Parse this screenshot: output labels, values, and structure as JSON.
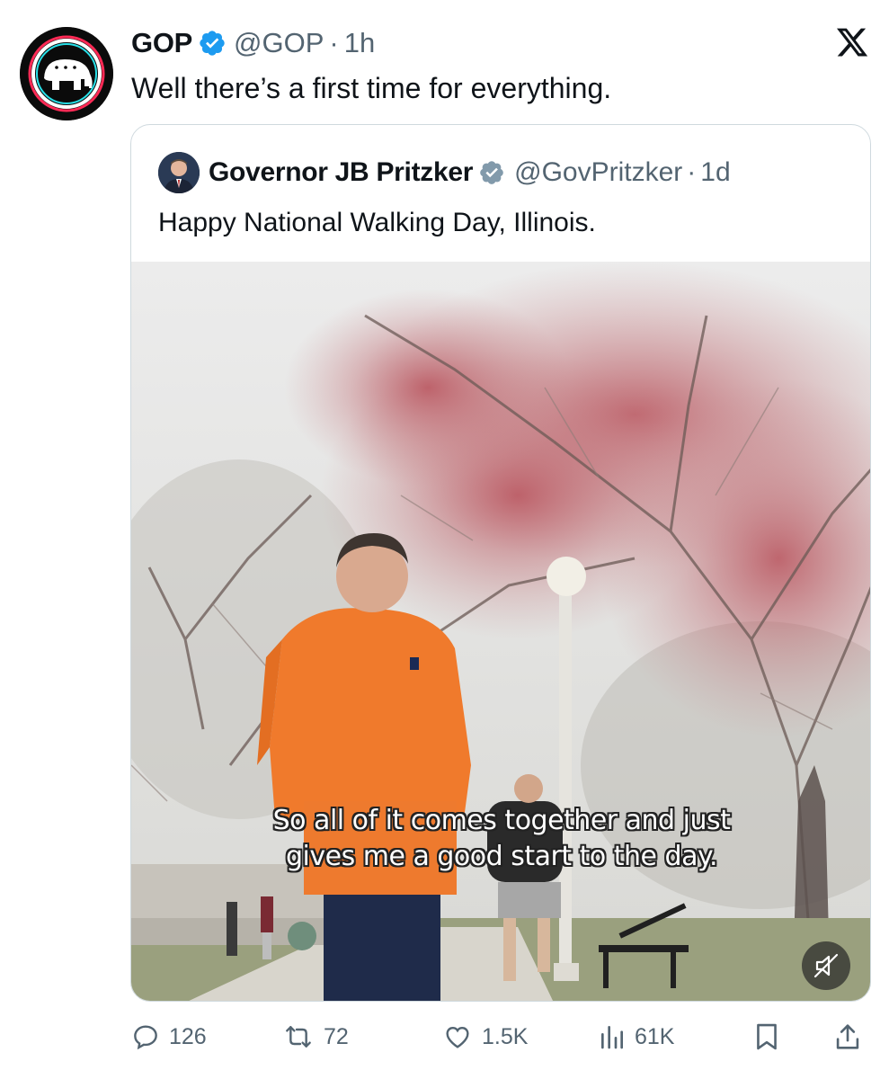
{
  "post": {
    "author_name": "GOP",
    "handle": "@GOP",
    "separator": "·",
    "time": "1h",
    "text": "Well there’s a first time for everything.",
    "avatar_icon": "republican-elephant-logo"
  },
  "quoted_post": {
    "author_name": "Governor JB Pritzker",
    "handle": "@GovPritzker",
    "separator": "·",
    "time": "1d",
    "text": "Happy National Walking Day, Illinois.",
    "video_caption_lines": [
      "So all of it comes together and just",
      "gives me a good start to the day."
    ]
  },
  "actions": {
    "replies": "126",
    "reposts": "72",
    "likes": "1.5K",
    "views": "61K"
  },
  "colors": {
    "verified_blue": "#1d9bf0",
    "muted_text": "#536471",
    "border": "#cfd9de"
  },
  "icons": [
    "x-logo-icon",
    "verified-badge-icon",
    "reply-icon",
    "repost-icon",
    "like-icon",
    "views-icon",
    "bookmark-icon",
    "share-icon",
    "mute-icon"
  ]
}
